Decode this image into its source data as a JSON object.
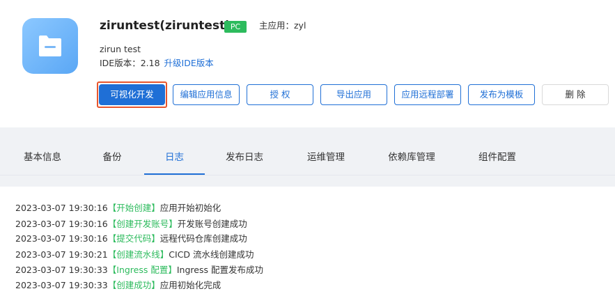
{
  "app": {
    "title": "ziruntest(ziruntest)",
    "badge": "PC",
    "owner": "主应用：zyl",
    "description": "zirun test",
    "ide_version": "IDE版本：2.18",
    "ide_upgrade_link": "升级IDE版本"
  },
  "actions": {
    "visual_dev": "可视化开发",
    "edit_info": "编辑应用信息",
    "authorize": "授 权",
    "export": "导出应用",
    "remote_deploy": "应用远程部署",
    "publish_template": "发布为模板",
    "delete": "删 除"
  },
  "tabs": [
    {
      "label": "基本信息",
      "active": false
    },
    {
      "label": "备份",
      "active": false
    },
    {
      "label": "日志",
      "active": true
    },
    {
      "label": "发布日志",
      "active": false
    },
    {
      "label": "运维管理",
      "active": false
    },
    {
      "label": "依赖库管理",
      "active": false
    },
    {
      "label": "组件配置",
      "active": false
    }
  ],
  "logs": [
    {
      "time": "2023-03-07 19:30:16",
      "tag": "【开始创建】",
      "message": "应用开始初始化"
    },
    {
      "time": "2023-03-07 19:30:16",
      "tag": "【创建开发账号】",
      "message": "开发账号创建成功"
    },
    {
      "time": "2023-03-07 19:30:16",
      "tag": "【提交代码】",
      "message": "远程代码仓库创建成功"
    },
    {
      "time": "2023-03-07 19:30:21",
      "tag": "【创建流水线】",
      "message": "CICD 流水线创建成功"
    },
    {
      "time": "2023-03-07 19:30:33",
      "tag": "【Ingress 配置】",
      "message": "Ingress 配置发布成功"
    },
    {
      "time": "2023-03-07 19:30:33",
      "tag": "【创建成功】",
      "message": "应用初始化完成"
    }
  ],
  "colors": {
    "primary": "#1f6fd6",
    "success": "#2dbb5d",
    "highlight_outline": "#e8552c"
  },
  "icons": {
    "app_icon": "folder-icon"
  }
}
